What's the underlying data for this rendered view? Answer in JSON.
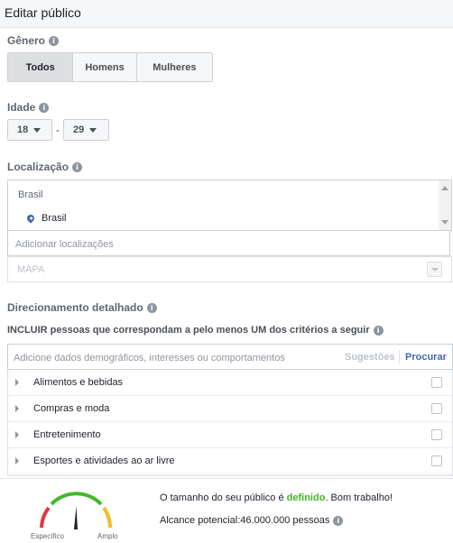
{
  "header": {
    "title": "Editar público"
  },
  "gender": {
    "label": "Gênero",
    "options": [
      "Todos",
      "Homens",
      "Mulheres"
    ],
    "selected": "Todos"
  },
  "age": {
    "label": "Idade",
    "min": "18",
    "dash": "-",
    "max": "29"
  },
  "location": {
    "label": "Localização",
    "country_header": "Brasil",
    "selected_item": "Brasil",
    "add_placeholder": "Adicionar localizações",
    "map_label": "MAPA"
  },
  "targeting": {
    "label": "Direcionamento detalhado",
    "include_text": "INCLUIR pessoas que correspondam a pelo menos UM dos critérios a seguir",
    "search_placeholder": "Adicione dados demográficos, interesses ou comportamentos",
    "suggestions_label": "Sugestões",
    "browse_label": "Procurar",
    "categories": [
      "Alimentos e bebidas",
      "Compras e moda",
      "Entretenimento",
      "Esportes e atividades ao ar livre"
    ]
  },
  "audience": {
    "gauge_left": "Específico",
    "gauge_right": "Amplo",
    "status_prefix": "O tamanho do seu público é ",
    "status_strong": "definido",
    "status_suffix": ". Bom trabalho!",
    "reach_text": "Alcance potencial:46.000.000 pessoas",
    "colors": {
      "red": "#e0393e",
      "green": "#42b72a",
      "yellow": "#f7b928"
    }
  },
  "icons": {
    "info": "info-icon",
    "location_pin": "location-pin-icon"
  }
}
